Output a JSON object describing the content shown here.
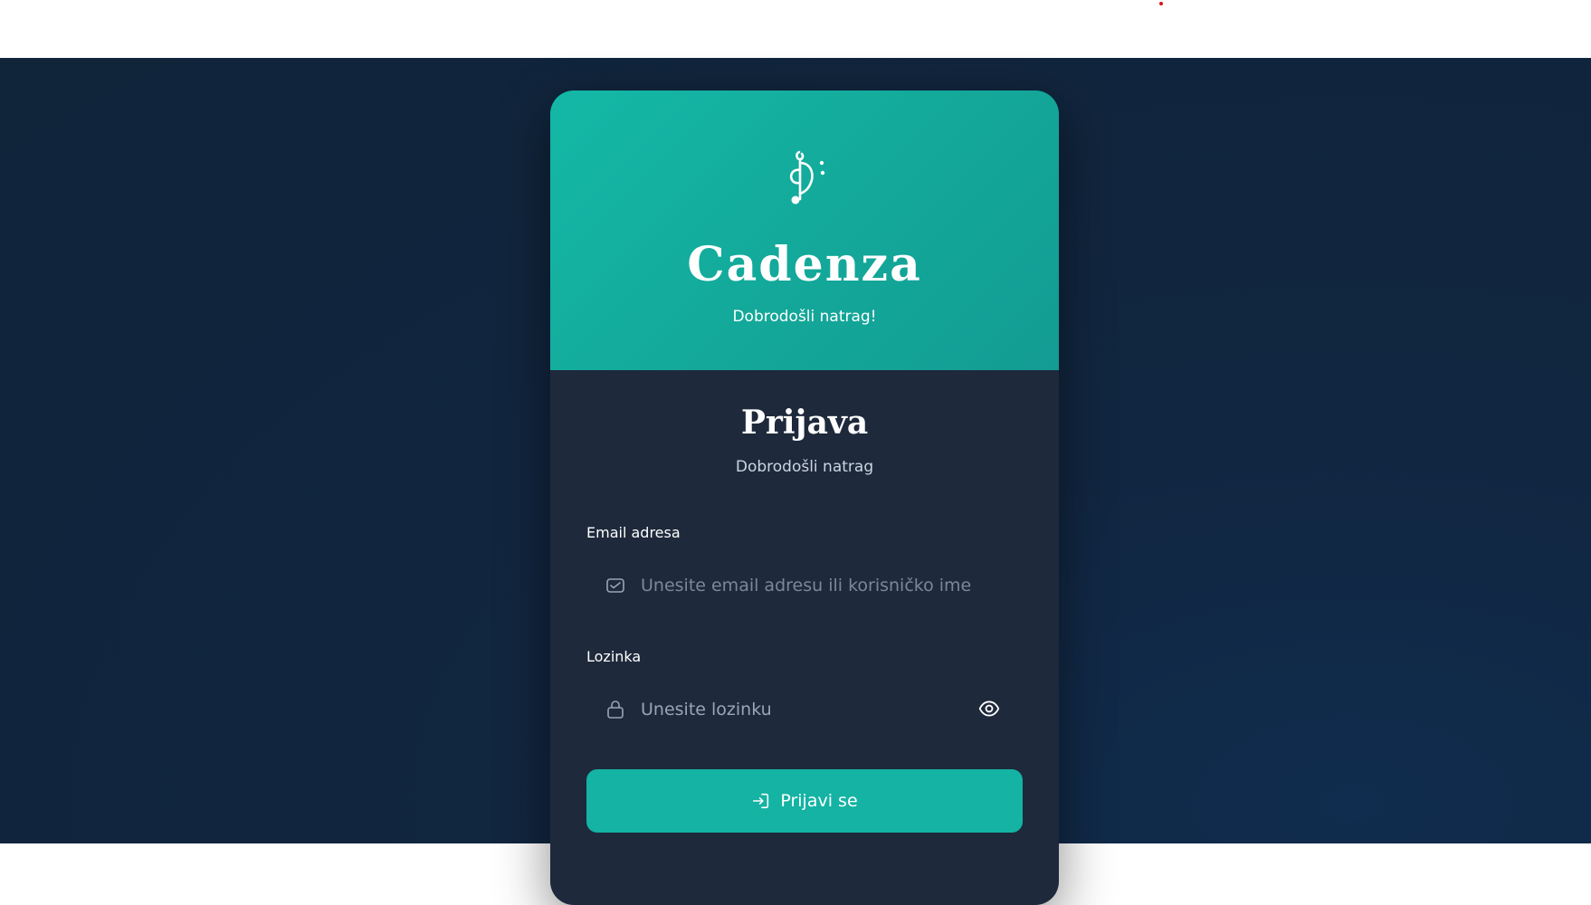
{
  "app": {
    "brand": "Cadenza",
    "tagline": "Dobrodošli natrag!"
  },
  "login": {
    "title": "Prijava",
    "subtitle": "Dobrodošli natrag",
    "email_label": "Email adresa",
    "email_placeholder": "Unesite email adresu ili korisničko ime",
    "password_label": "Lozinka",
    "password_placeholder": "Unesite lozinku",
    "submit_label": "Prijavi se"
  },
  "icons": {
    "logo": "music-note-icon",
    "email": "mail-icon",
    "password": "lock-icon",
    "toggle_password": "eye-icon",
    "submit": "login-icon"
  },
  "colors": {
    "accent": "#14b8a6",
    "card": "#1e293b",
    "background": "#10243a"
  }
}
